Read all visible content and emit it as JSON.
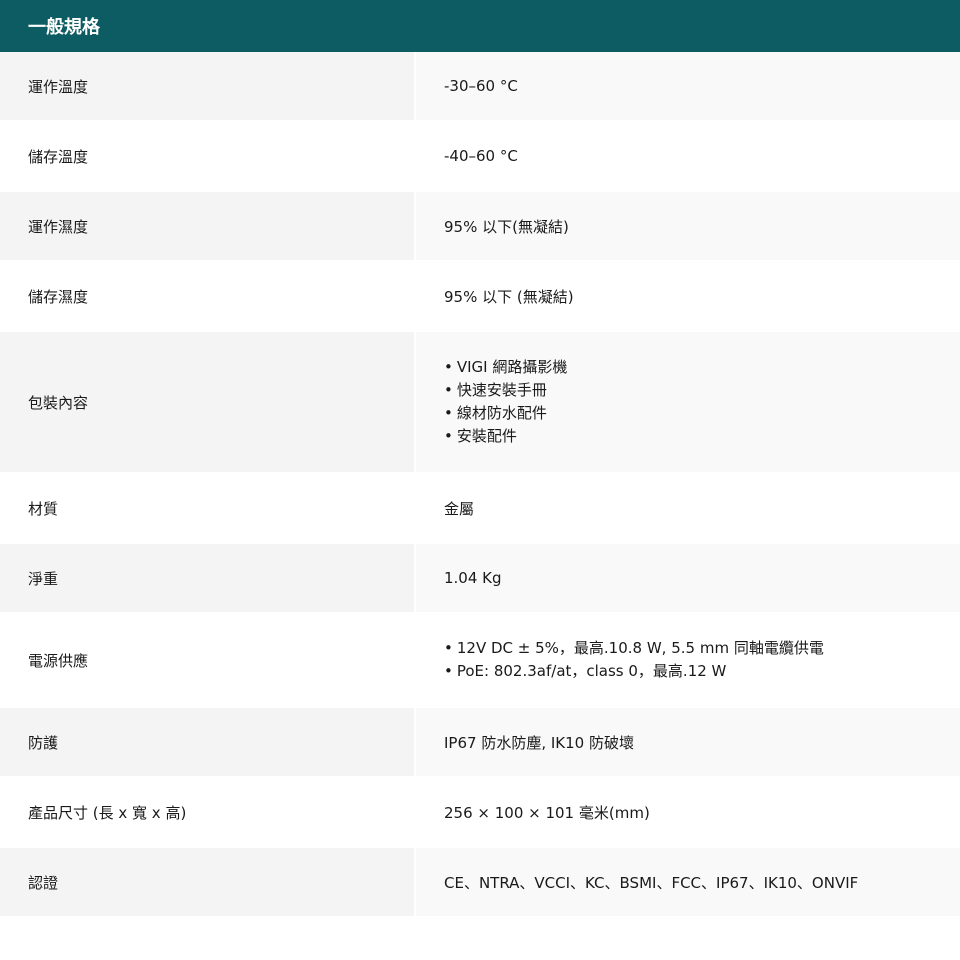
{
  "header": {
    "title": "一般規格"
  },
  "rows": [
    {
      "label": "運作溫度",
      "value": "-30–60 °C"
    },
    {
      "label": "儲存溫度",
      "value": "-40–60 °C"
    },
    {
      "label": "運作濕度",
      "value": "95% 以下(無凝結)"
    },
    {
      "label": "儲存濕度",
      "value": "95% 以下 (無凝結)"
    },
    {
      "label": "包裝內容",
      "items": [
        "VIGI 網路攝影機",
        "快速安裝手冊",
        "線材防水配件",
        "安裝配件"
      ]
    },
    {
      "label": "材質",
      "value": "金屬"
    },
    {
      "label": "淨重",
      "value": "1.04 Kg"
    },
    {
      "label": "電源供應",
      "items": [
        "12V DC ± 5%，最高.10.8 W, 5.5 mm 同軸電纜供電",
        "PoE: 802.3af/at，class 0，最高.12 W"
      ]
    },
    {
      "label": "防護",
      "value": "IP67 防水防塵, IK10 防破壞"
    },
    {
      "label": "產品尺寸 (長 x 寬 x 高)",
      "value": "256 × 100 × 101 毫米(mm)"
    },
    {
      "label": "認證",
      "value": "CE、NTRA、VCCI、KC、BSMI、FCC、IP67、IK10、ONVIF"
    }
  ]
}
